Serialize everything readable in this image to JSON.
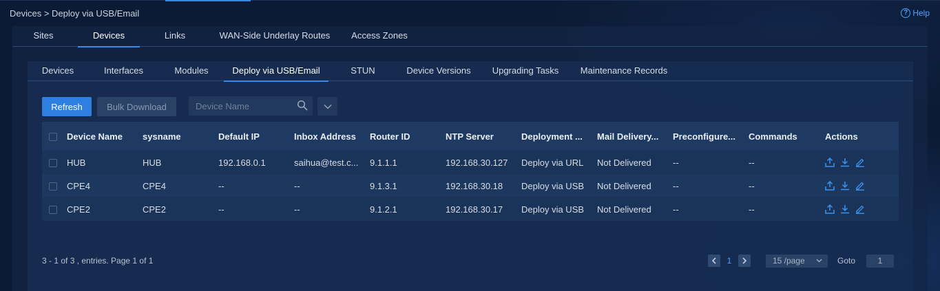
{
  "breadcrumb": "Devices > Deploy via USB/Email",
  "help_label": "Help",
  "main_tabs": [
    {
      "label": "Sites"
    },
    {
      "label": "Devices"
    },
    {
      "label": "Links"
    },
    {
      "label": "WAN-Side Underlay Routes"
    },
    {
      "label": "Access Zones"
    }
  ],
  "sub_tabs": [
    {
      "label": "Devices"
    },
    {
      "label": "Interfaces"
    },
    {
      "label": "Modules"
    },
    {
      "label": "Deploy via USB/Email"
    },
    {
      "label": "STUN"
    },
    {
      "label": "Device Versions"
    },
    {
      "label": "Upgrading Tasks"
    },
    {
      "label": "Maintenance Records"
    }
  ],
  "toolbar": {
    "refresh_label": "Refresh",
    "bulk_download_label": "Bulk Download",
    "search_placeholder": "Device Name"
  },
  "table": {
    "headers": [
      "Device Name",
      "sysname",
      "Default IP",
      "Inbox Address",
      "Router ID",
      "NTP Server",
      "Deployment ...",
      "Mail Delivery...",
      "Preconfigure...",
      "Commands",
      "Actions"
    ],
    "rows": [
      [
        "HUB",
        "HUB",
        "192.168.0.1",
        "saihua@test.c...",
        "9.1.1.1",
        "192.168.30.127",
        "Deploy via URL",
        "Not Delivered",
        "--",
        "--"
      ],
      [
        "CPE4",
        "CPE4",
        "--",
        "--",
        "9.1.3.1",
        "192.168.30.18",
        "Deploy via USB",
        "Not Delivered",
        "--",
        "--"
      ],
      [
        "CPE2",
        "CPE2",
        "--",
        "--",
        "9.1.2.1",
        "192.168.30.17",
        "Deploy via USB",
        "Not Delivered",
        "--",
        "--"
      ]
    ]
  },
  "footer": {
    "summary": "3 - 1 of 3 , entries. Page 1 of 1",
    "current_page": "1",
    "per_page": "15 /page",
    "goto_label": "Goto",
    "goto_value": "1"
  },
  "colors": {
    "accent": "#2d7fe0",
    "link": "#4ea2ff",
    "background": "#0c1b35"
  }
}
